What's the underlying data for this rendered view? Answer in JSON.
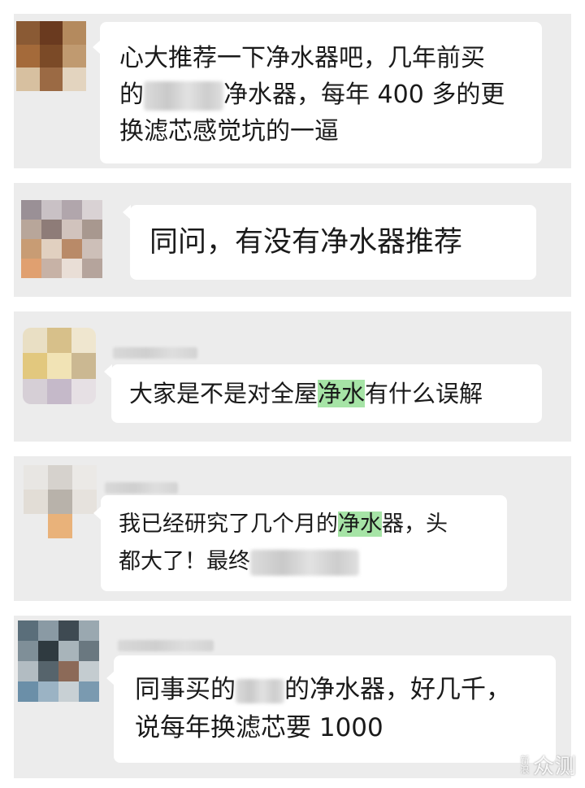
{
  "messages": [
    {
      "id": 1,
      "lines": [
        {
          "text": "心大推荐一下净水器吧，几年前买"
        },
        {
          "prefix": "的",
          "suffix": "净水器，每年 400 多的更"
        },
        {
          "text": "换滤芯感觉坑的一逼"
        }
      ]
    },
    {
      "id": 2,
      "lines": [
        {
          "text": "同问，有没有净水器推荐"
        }
      ]
    },
    {
      "id": 3,
      "lines": [
        {
          "prefix": "大家是不是对全屋",
          "highlight": "净水",
          "suffix": "有什么误解"
        }
      ]
    },
    {
      "id": 4,
      "lines": [
        {
          "prefix": "我已经研究了几个月的",
          "highlight": "净水",
          "suffix": "器，头"
        },
        {
          "prefix": "都大了！最终"
        }
      ]
    },
    {
      "id": 5,
      "lines": [
        {
          "prefix": "同事买的",
          "suffix": "的净水器，好几千，"
        },
        {
          "text": "说每年换滤芯要 1000"
        }
      ]
    }
  ],
  "watermark": {
    "small_top": "新",
    "small_bottom": "浪",
    "big": "众测"
  },
  "colors": {
    "panel_bg": "#ececec",
    "bubble_bg": "#ffffff",
    "highlight": "#a6e4a6"
  }
}
